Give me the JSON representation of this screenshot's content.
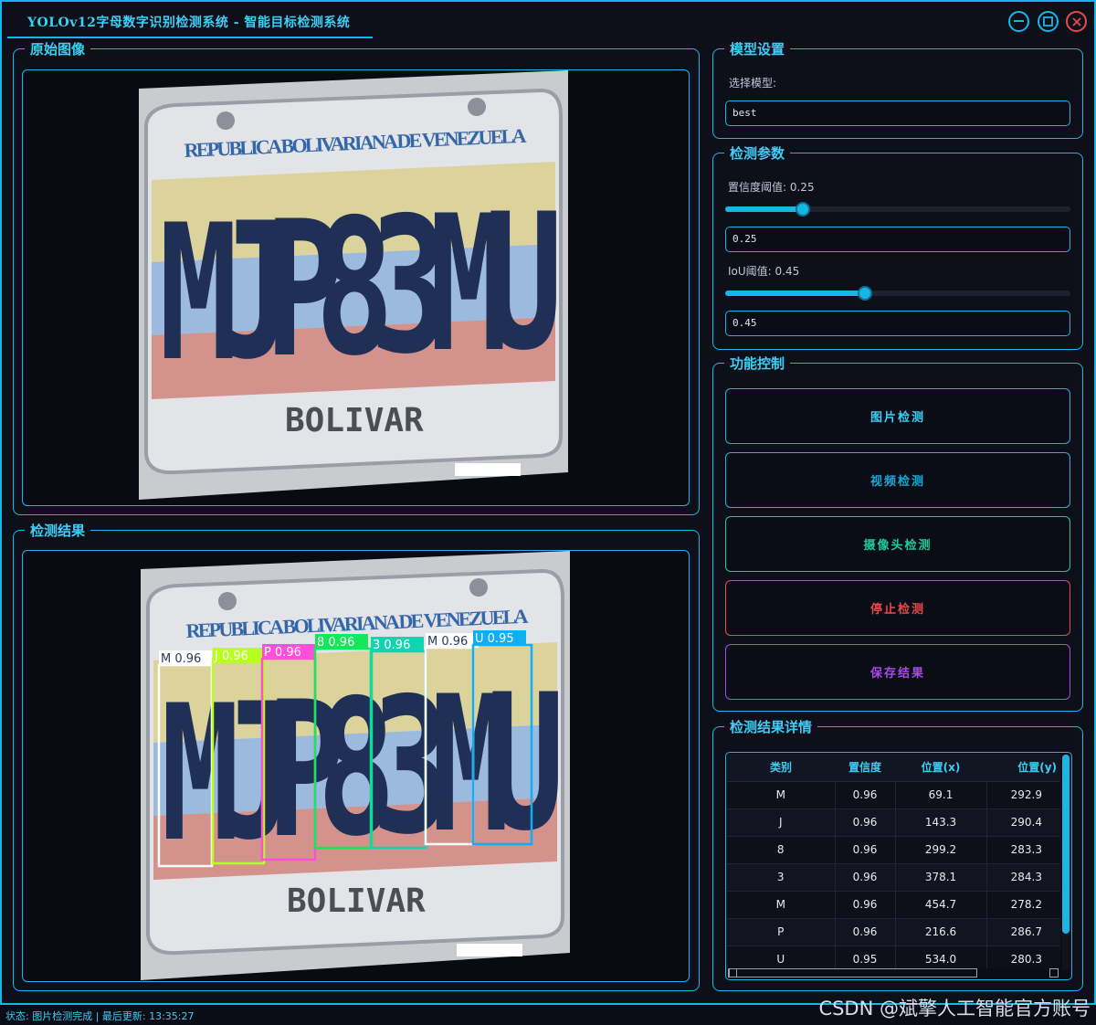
{
  "window": {
    "title": "YOLOv12字母数字识别检测系统 - 智能目标检测系统",
    "controls": [
      "minimize-icon",
      "maximize-icon",
      "close-icon"
    ]
  },
  "panels": {
    "original": {
      "title": "原始图像"
    },
    "result": {
      "title": "检测结果"
    }
  },
  "plate": {
    "top_text": "REPUBLICA BOLIVARIANA DE VENEZUELA",
    "chars": [
      "M",
      "J",
      "P",
      "8",
      "3",
      "M",
      "U"
    ],
    "bottom_text": "BOLIVAR"
  },
  "detections_overlay": [
    {
      "label": "M 0.96",
      "color": "#ffffff"
    },
    {
      "label": "J 0.96",
      "color": "#b8ff20"
    },
    {
      "label": "P 0.96",
      "color": "#ff4fd8"
    },
    {
      "label": "8 0.96",
      "color": "#13e85a"
    },
    {
      "label": "3 0.96",
      "color": "#14d4b0"
    },
    {
      "label": "M 0.96",
      "color": "#ffffff"
    },
    {
      "label": "U 0.95",
      "color": "#12aef5"
    }
  ],
  "model_settings": {
    "title": "模型设置",
    "select_label": "选择模型:",
    "model_value": "best"
  },
  "detect_params": {
    "title": "检测参数",
    "conf_label": "置信度阈值: 0.25",
    "conf_value": "0.25",
    "conf_level": 0.25,
    "iou_label": "IoU阈值: 0.45",
    "iou_value": "0.45",
    "iou_level": 0.45
  },
  "controls": {
    "title": "功能控制",
    "image_detect": "图片检测",
    "video_detect": "视频检测",
    "camera_detect": "摄像头检测",
    "stop_detect": "停止检测",
    "save_result": "保存结果",
    "colors": {
      "image": "#17b6e6",
      "video": "#17b6e6",
      "camera": "#20c997",
      "stop": "#e64b4b",
      "save": "#a64be6"
    }
  },
  "details": {
    "title": "检测结果详情",
    "columns": [
      "类别",
      "置信度",
      "位置(x)",
      "位置(y)"
    ],
    "rows": [
      [
        "M",
        "0.96",
        "69.1",
        "292.9"
      ],
      [
        "J",
        "0.96",
        "143.3",
        "290.4"
      ],
      [
        "8",
        "0.96",
        "299.2",
        "283.3"
      ],
      [
        "3",
        "0.96",
        "378.1",
        "284.3"
      ],
      [
        "M",
        "0.96",
        "454.7",
        "278.2"
      ],
      [
        "P",
        "0.96",
        "216.6",
        "286.7"
      ],
      [
        "U",
        "0.95",
        "534.0",
        "280.3"
      ]
    ]
  },
  "status": {
    "text": "状态: 图片检测完成 | 最后更新: 13:35:27"
  },
  "watermark": "CSDN @斌擎人工智能官方账号"
}
